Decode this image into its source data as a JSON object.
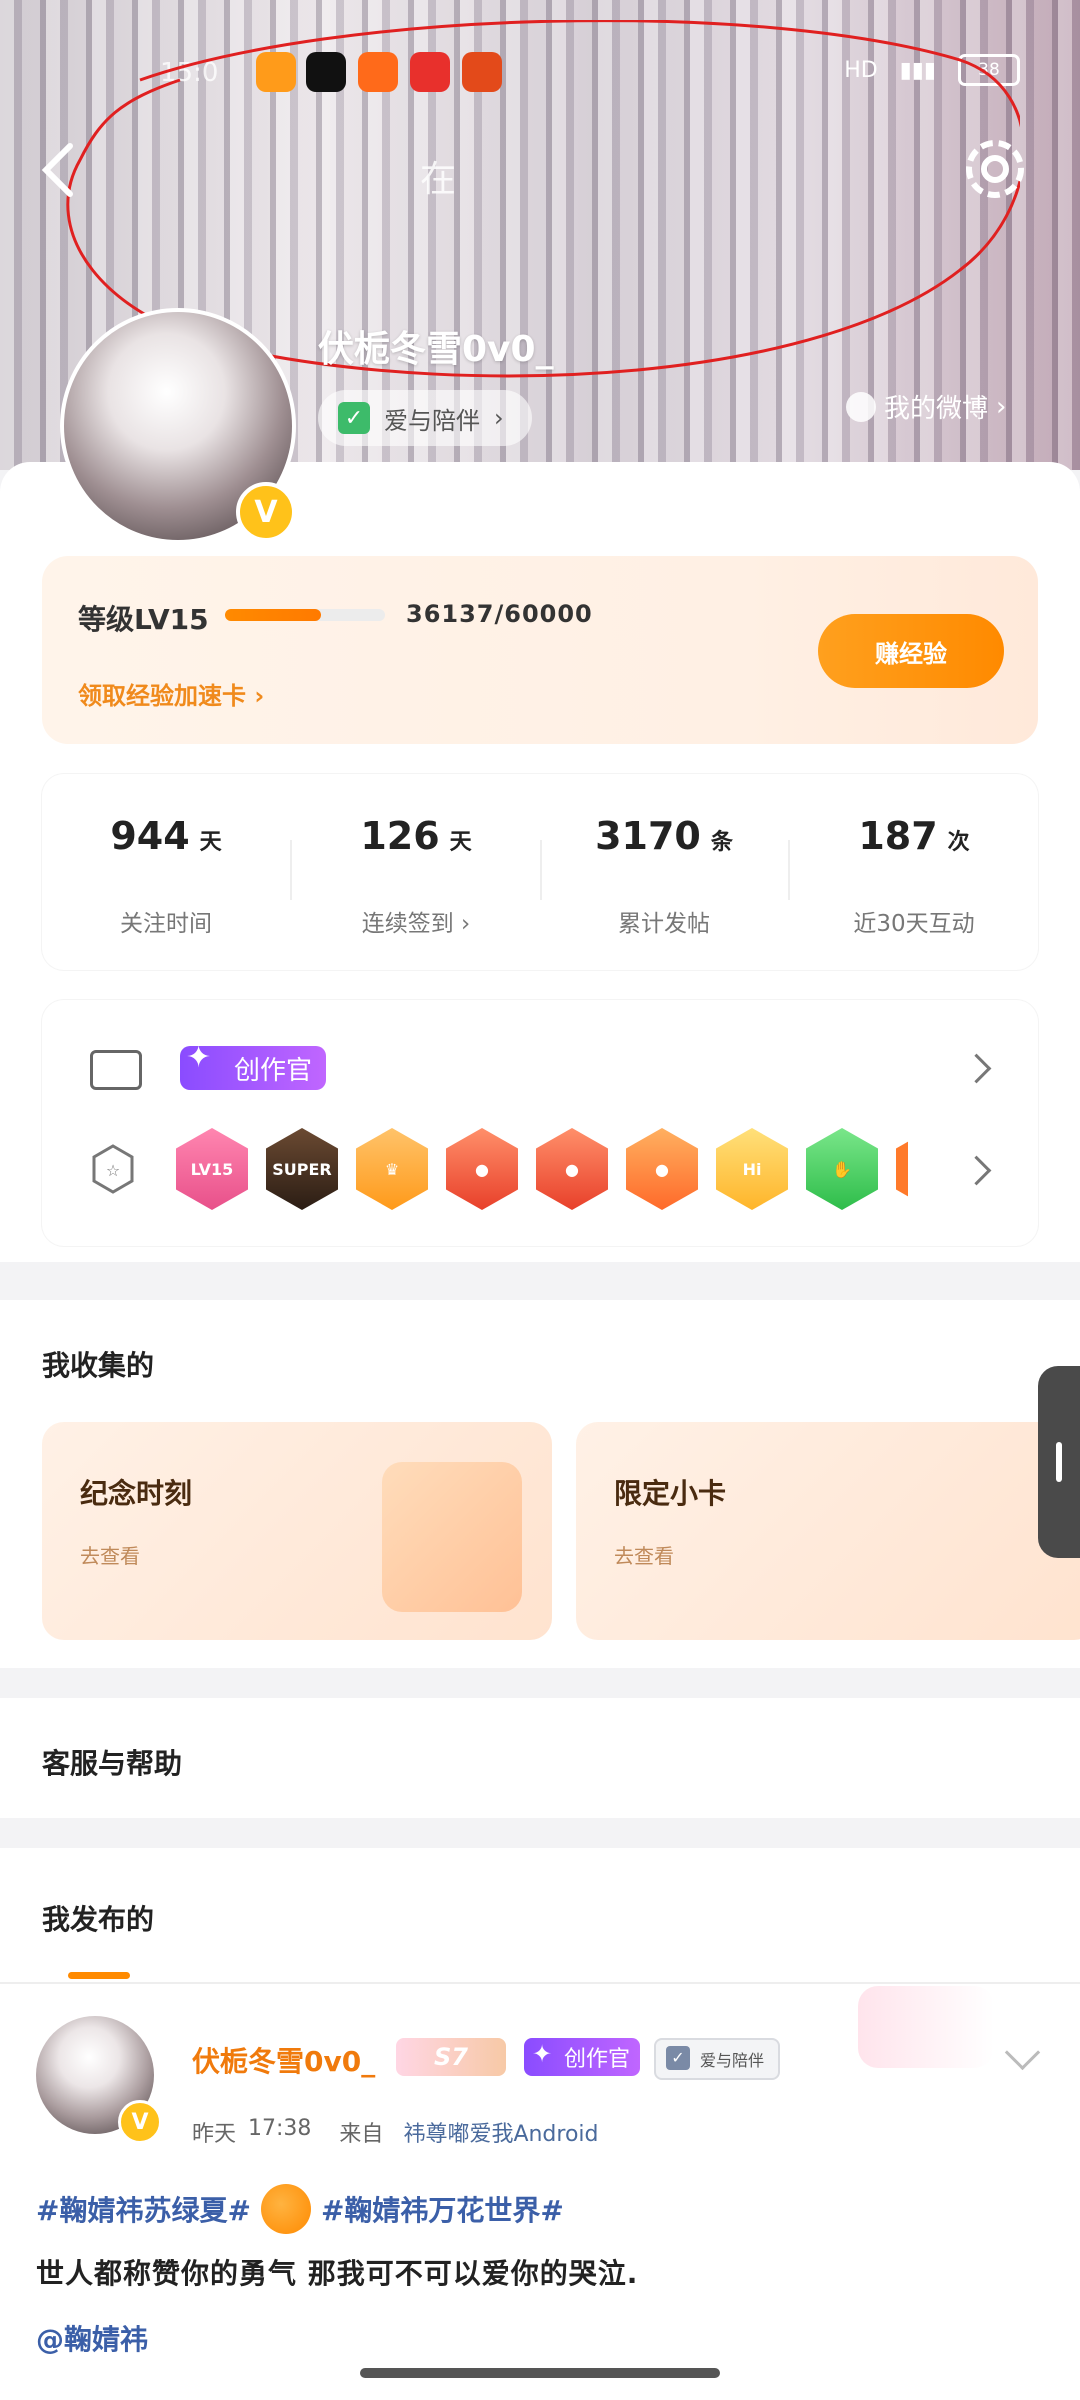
{
  "status_bar": {
    "time": "15:0",
    "network": "HD",
    "battery": "38"
  },
  "header": {
    "title": "在",
    "username": "伏栀冬雪0v0_",
    "companion_tag": "爱与陪伴",
    "weibo_link": "我的微博"
  },
  "level": {
    "label": "等级LV15",
    "progress_text": "36137/60000",
    "progress_fraction": 0.6,
    "boost_link": "领取经验加速卡",
    "earn_button": "赚经验"
  },
  "stats": [
    {
      "value": "944",
      "unit": "天",
      "label": "关注时间"
    },
    {
      "value": "126",
      "unit": "天",
      "label": "连续签到"
    },
    {
      "value": "3170",
      "unit": "条",
      "label": "累计发帖"
    },
    {
      "value": "187",
      "unit": "次",
      "label": "近30天互动"
    }
  ],
  "badges": {
    "creator_tag": "创作官",
    "medals": [
      "LV15",
      "SUPER",
      "",
      "",
      "",
      "",
      "Hi",
      ""
    ]
  },
  "collection": {
    "title": "我收集的",
    "cards": [
      {
        "title": "纪念时刻",
        "sub": "去查看"
      },
      {
        "title": "限定小卡",
        "sub": "去查看"
      }
    ]
  },
  "help": {
    "title": "客服与帮助"
  },
  "mine": {
    "title": "我发布的"
  },
  "post": {
    "username": "伏栀冬雪0v0_",
    "season_tag": "S7",
    "creator_tag": "创作官",
    "companion_tag": "爱与陪伴",
    "time_day": "昨天",
    "time": "17:38",
    "source_label": "来自",
    "device": "祎尊嘟爱我Android",
    "hashtag1": "#鞠婧祎苏绿夏#",
    "hashtag2": "#鞠婧祎万花世界#",
    "text": "世人都称赞你的勇气  那我可不可以爱你的哭泣.",
    "mention": "@鞠婧祎"
  },
  "colors": {
    "accent": "#ff8a00",
    "link": "#3b5fa8",
    "creator": "#8a4cff"
  }
}
